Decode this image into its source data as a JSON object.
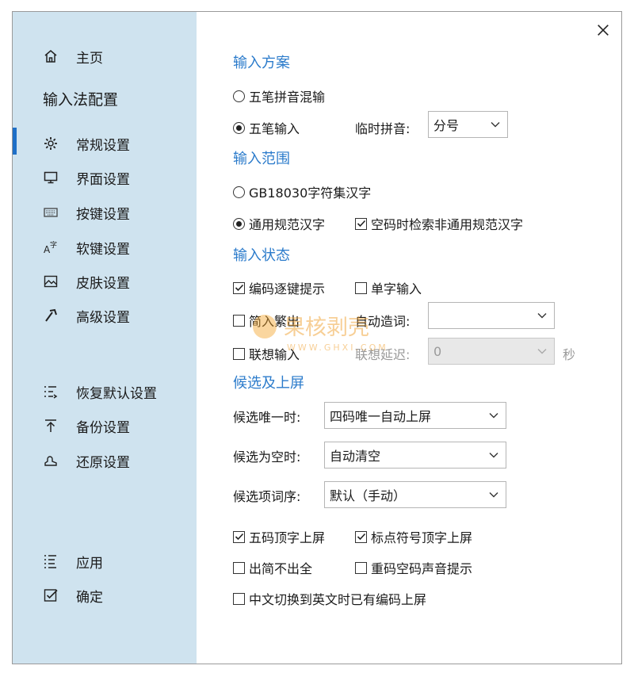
{
  "sidebar": {
    "home": "主页",
    "section_title": "输入法配置",
    "items": [
      {
        "label": "常规设置",
        "icon": "gear-icon"
      },
      {
        "label": "界面设置",
        "icon": "monitor-icon"
      },
      {
        "label": "按键设置",
        "icon": "keyboard-icon"
      },
      {
        "label": "软键设置",
        "icon": "soft-keyboard-icon"
      },
      {
        "label": "皮肤设置",
        "icon": "picture-icon"
      },
      {
        "label": "高级设置",
        "icon": "hammer-icon"
      }
    ],
    "actions": [
      {
        "label": "恢复默认设置",
        "icon": "restore-list-icon"
      },
      {
        "label": "备份设置",
        "icon": "upload-arrow-icon"
      },
      {
        "label": "还原设置",
        "icon": "restore-icon"
      }
    ],
    "bottom": [
      {
        "label": "应用",
        "icon": "list-icon"
      },
      {
        "label": "确定",
        "icon": "checkbox-icon"
      }
    ]
  },
  "content": {
    "sections": {
      "input_scheme": "输入方案",
      "input_range": "输入范围",
      "input_state": "输入状态",
      "candidate": "候选及上屏"
    },
    "scheme": {
      "opt_mixed": "五笔拼音混输",
      "opt_wubi": "五笔输入",
      "temp_pinyin_label": "临时拼音:",
      "temp_pinyin_value": "分号"
    },
    "range": {
      "opt_gb": "GB18030字符集汉字",
      "opt_common": "通用规范汉字",
      "chk_search": "空码时检索非通用规范汉字"
    },
    "state": {
      "chk_hint": "编码逐键提示",
      "chk_single": "单字输入",
      "chk_trad": "简入繁出",
      "auto_word_label": "自动造词:",
      "auto_word_value": "",
      "chk_assoc": "联想输入",
      "assoc_delay_label": "联想延迟:",
      "assoc_delay_value": "0",
      "assoc_unit": "秒"
    },
    "candidate": {
      "unique_label": "候选唯一时:",
      "unique_value": "四码唯一自动上屏",
      "empty_label": "候选为空时:",
      "empty_value": "自动清空",
      "order_label": "候选项词序:",
      "order_value": "默认（手动）",
      "chk_five_top": "五码顶字上屏",
      "chk_punct_top": "标点符号顶字上屏",
      "chk_simple": "出简不出全",
      "chk_sound": "重码空码声音提示",
      "chk_switch": "中文切换到英文时已有编码上屏"
    }
  },
  "watermark": {
    "text": "果核剥壳",
    "sub": "WWW.GHXI.COM"
  },
  "colors": {
    "sidebar_bg": "#cfe3ef",
    "accent": "#2b7bcb",
    "active_bar": "#1e6fc7"
  }
}
